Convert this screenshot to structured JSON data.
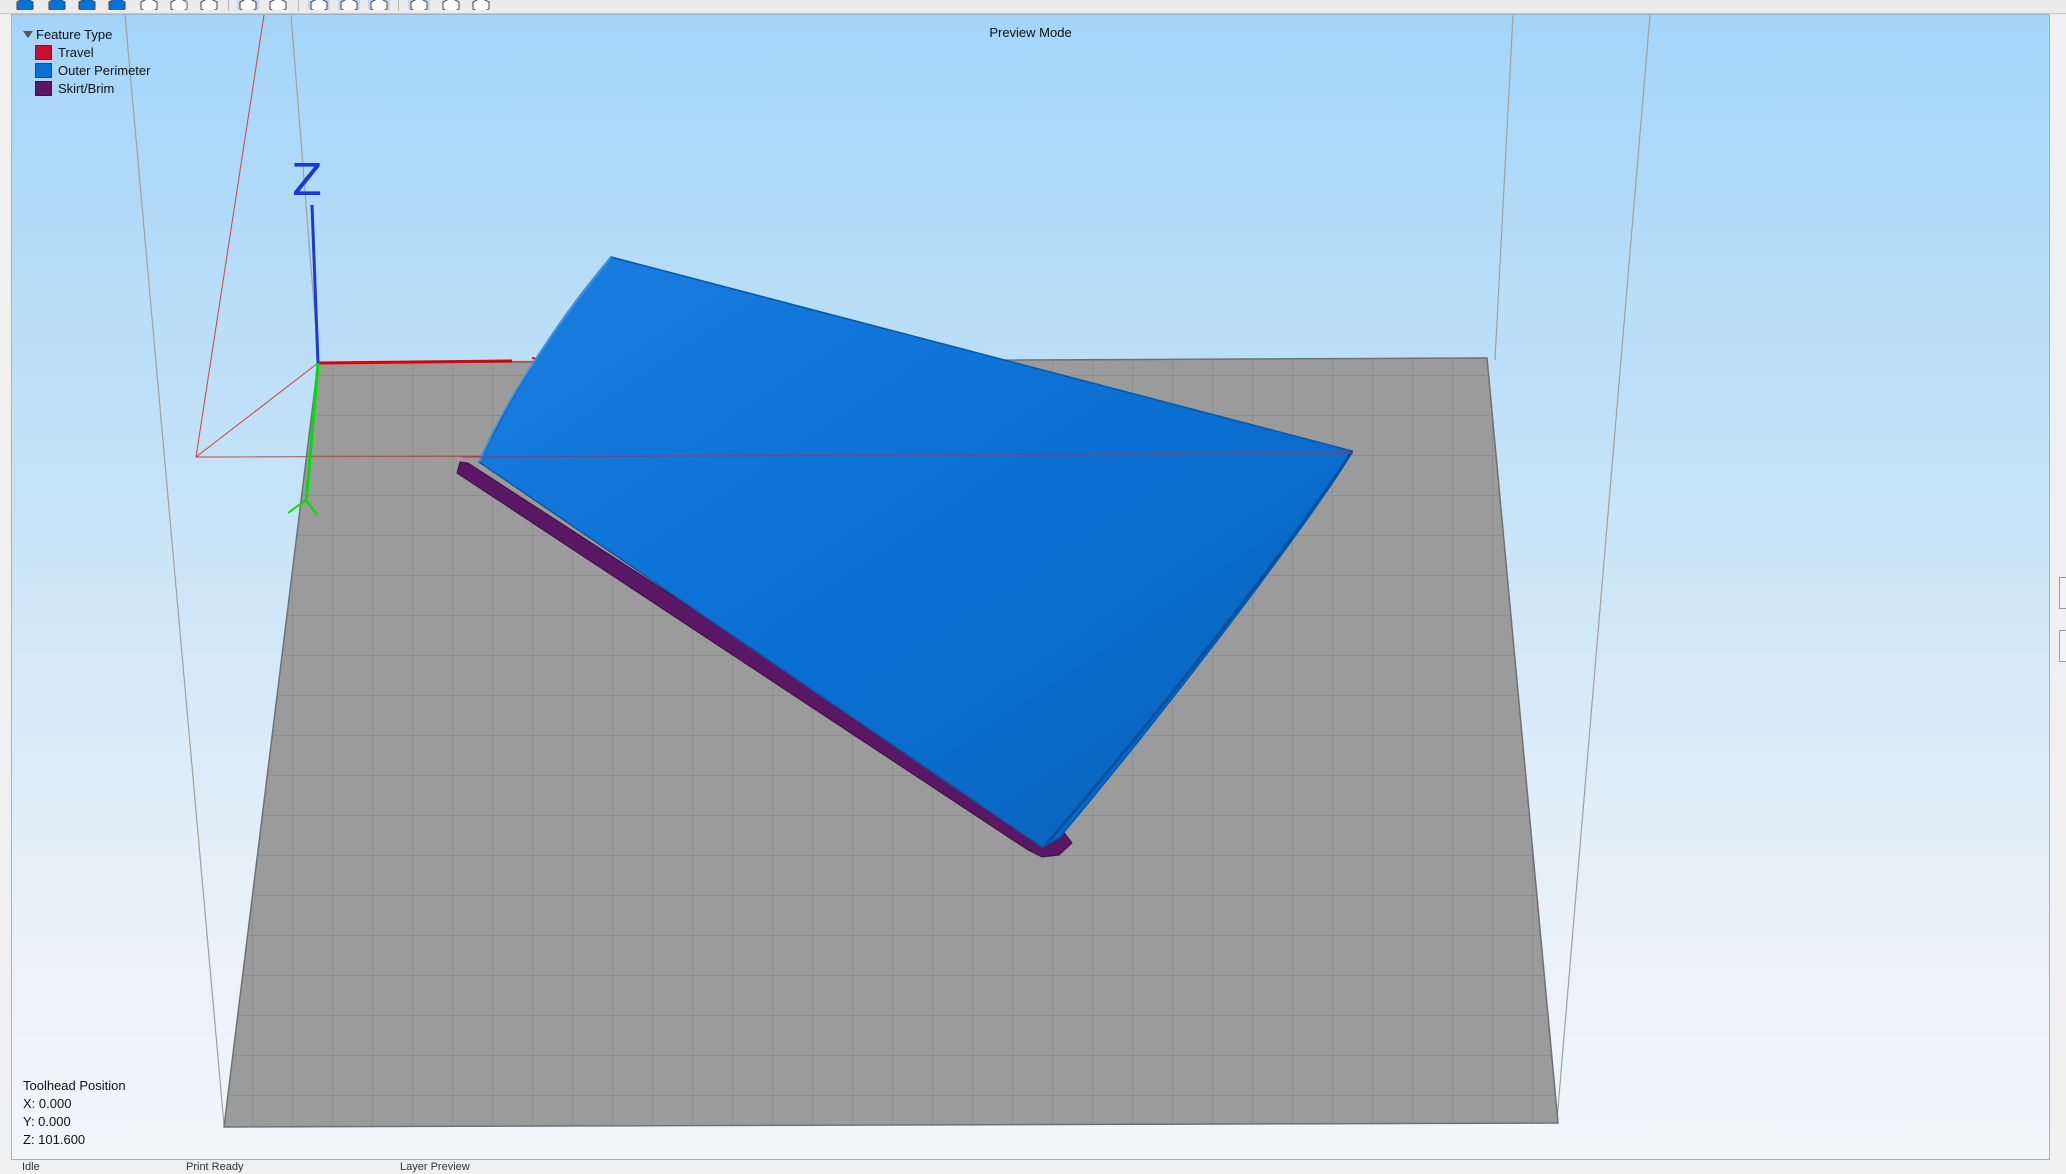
{
  "toolbar": {
    "buttons": [
      {
        "name": "view-iso-button",
        "icon": "cube-iso-icon",
        "active": false
      },
      {
        "name": "view-front-button",
        "icon": "cube-front-icon",
        "active": false
      },
      {
        "name": "view-back-button",
        "icon": "cube-back-icon",
        "active": false
      },
      {
        "name": "view-left-button",
        "icon": "cube-left-icon",
        "active": false
      },
      {
        "name": "view-right-button",
        "icon": "cube-right-icon",
        "active": false
      },
      {
        "name": "view-top-button",
        "icon": "cube-top-icon",
        "active": false
      },
      {
        "name": "view-bottom-button",
        "icon": "cube-bottom-icon",
        "active": false
      },
      {
        "name": "perspective-button",
        "icon": "perspective-icon",
        "active": true
      },
      {
        "name": "orthographic-button",
        "icon": "orthographic-icon",
        "active": false
      },
      {
        "name": "show-axes-button",
        "icon": "axes-icon",
        "active": true
      },
      {
        "name": "show-bed-button",
        "icon": "bed-icon",
        "active": true
      },
      {
        "name": "show-build-volume-button",
        "icon": "build-volume-icon",
        "active": true
      },
      {
        "name": "shaded-view-button",
        "icon": "shaded-icon",
        "active": true
      },
      {
        "name": "wireframe-view-button",
        "icon": "wireframe-icon",
        "active": false
      },
      {
        "name": "xray-view-button",
        "icon": "xray-icon",
        "active": false
      }
    ]
  },
  "viewport": {
    "mode_title": "Preview Mode",
    "axis_label_z": "Z",
    "legend": {
      "title": "Feature Type",
      "items": [
        {
          "label": "Travel",
          "color": "#c8102e"
        },
        {
          "label": "Outer Perimeter",
          "color": "#0a72d6"
        },
        {
          "label": "Skirt/Brim",
          "color": "#5a1763"
        }
      ]
    },
    "toolhead": {
      "title": "Toolhead Position",
      "x": "X: 0.000",
      "y": "Y: 0.000",
      "z": "Z: 101.600"
    }
  },
  "colors": {
    "model_blue": "#0a72d6",
    "brim_purple": "#5a1763",
    "bed_gray": "#9a9a9a",
    "axis_x": "#e00000",
    "axis_y": "#00e000",
    "axis_z": "#1a3ad8"
  },
  "statusbar": {
    "left": "Idle",
    "middle": "Print Ready",
    "right": "Layer Preview"
  }
}
